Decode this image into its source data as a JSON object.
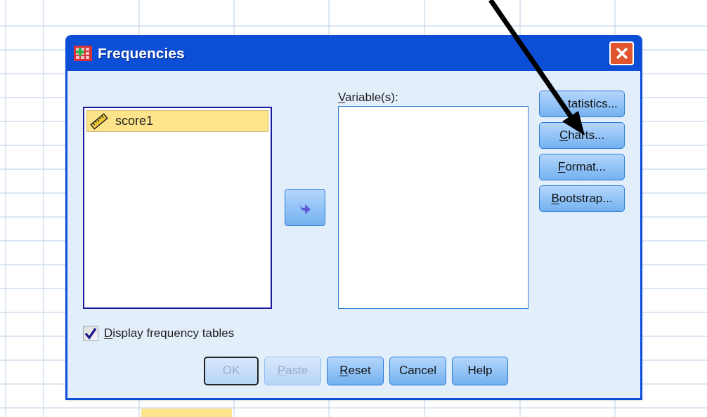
{
  "window": {
    "title": "Frequencies"
  },
  "source_list": {
    "items": [
      {
        "label": "score1",
        "selected": true
      }
    ]
  },
  "variables": {
    "label": "Variable(s):",
    "mnemonic_underlined": true
  },
  "side_buttons": [
    {
      "label": "tatistics...",
      "mnemonic_underlined": false
    },
    {
      "label": "Charts...",
      "mnemonic_underlined": true
    },
    {
      "label": "Format...",
      "mnemonic_underlined": true
    },
    {
      "label": "Bootstrap...",
      "mnemonic_underlined": true
    }
  ],
  "display_frequency_tables": {
    "label": "Display frequency tables",
    "checked": true,
    "mnemonic_underlined": true
  },
  "buttons": [
    {
      "label": "OK",
      "disabled": true,
      "default": true,
      "mnemonic_underlined": false
    },
    {
      "label": "Paste",
      "disabled": true,
      "default": false,
      "mnemonic_underlined": true
    },
    {
      "label": "Reset",
      "disabled": false,
      "default": false,
      "mnemonic_underlined": true
    },
    {
      "label": "Cancel",
      "disabled": false,
      "default": false,
      "mnemonic_underlined": false
    },
    {
      "label": "Help",
      "disabled": false,
      "default": false,
      "mnemonic_underlined": false
    }
  ]
}
